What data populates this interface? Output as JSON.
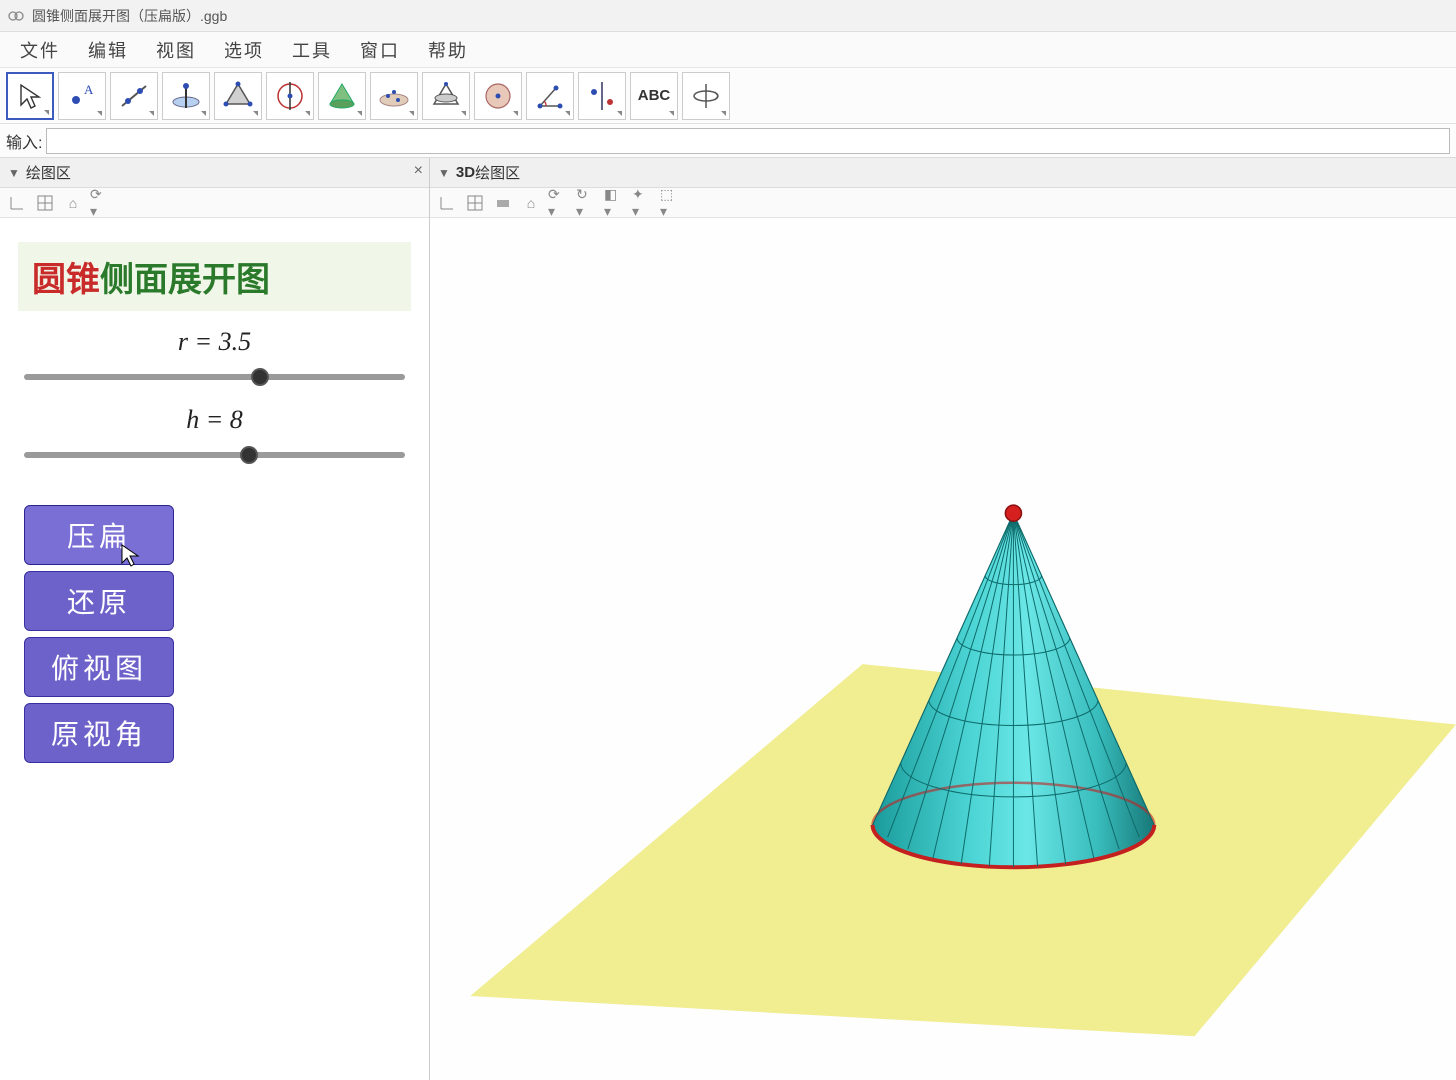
{
  "window": {
    "title": "圆锥侧面展开图（压扁版）.ggb"
  },
  "menubar": {
    "items": [
      "文件",
      "编辑",
      "视图",
      "选项",
      "工具",
      "窗口",
      "帮助"
    ]
  },
  "toolbar": {
    "tools": [
      "move",
      "point",
      "line",
      "perpendicular",
      "polygon",
      "circle",
      "ellipse",
      "conic",
      "angle",
      "transform",
      "slider",
      "text",
      "rotate-view"
    ],
    "text_label": "ABC"
  },
  "inputbar": {
    "label": "输入:",
    "value": ""
  },
  "panels": {
    "left": {
      "title": "绘图区"
    },
    "right": {
      "title_prefix": "3D ",
      "title": "绘图区"
    }
  },
  "left_content": {
    "title_part1": "圆锥",
    "title_part2": "侧面展开图",
    "slider_r": {
      "label": "r = 3.5",
      "value": 3.5,
      "min": 0,
      "max": 6,
      "pos_pct": 62
    },
    "slider_h": {
      "label": "h = 8",
      "value": 8,
      "min": 0,
      "max": 14,
      "pos_pct": 59
    },
    "buttons": {
      "flatten": "压扁",
      "restore": "还原",
      "top_view": "俯视图",
      "orig_view": "原视角"
    }
  }
}
